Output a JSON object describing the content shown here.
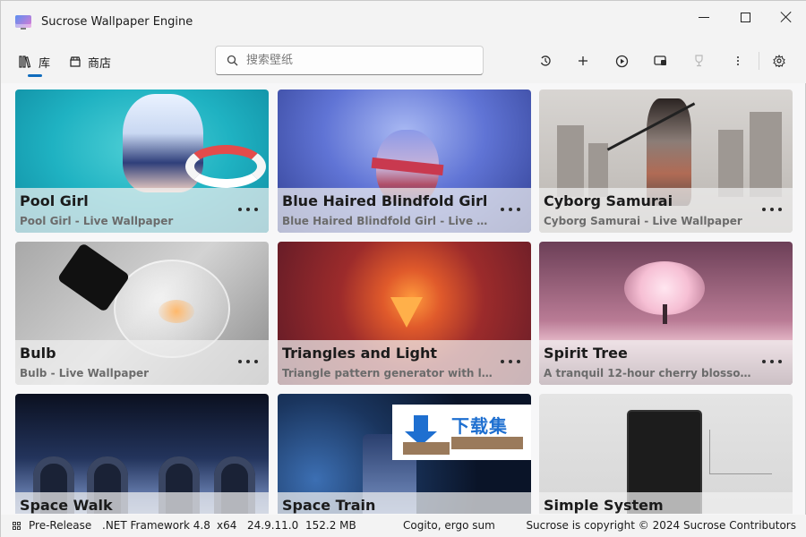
{
  "window": {
    "title": "Sucrose Wallpaper Engine"
  },
  "toolbar": {
    "tabs": [
      {
        "label": "库",
        "icon": "library-icon",
        "active": true
      },
      {
        "label": "商店",
        "icon": "store-icon",
        "active": false
      }
    ],
    "search": {
      "placeholder": "搜索壁纸",
      "value": ""
    },
    "actions": [
      "history-icon",
      "add-icon",
      "play-icon",
      "display-icon",
      "trophy-icon",
      "more-icon",
      "settings-icon"
    ]
  },
  "wallpapers": [
    {
      "title": "Pool Girl",
      "subtitle": "Pool Girl - Live Wallpaper"
    },
    {
      "title": "Blue Haired Blindfold Girl",
      "subtitle": "Blue Haired Blindfold Girl - Live Wal..."
    },
    {
      "title": "Cyborg Samurai",
      "subtitle": "Cyborg Samurai - Live Wallpaper"
    },
    {
      "title": "Bulb",
      "subtitle": "Bulb - Live Wallpaper"
    },
    {
      "title": "Triangles and Light",
      "subtitle": "Triangle pattern generator with ligh..."
    },
    {
      "title": "Spirit Tree",
      "subtitle": "A tranquil 12-hour cherry blossom l..."
    },
    {
      "title": "Space Walk",
      "subtitle": ""
    },
    {
      "title": "Space Train",
      "subtitle": ""
    },
    {
      "title": "Simple System",
      "subtitle": ""
    }
  ],
  "watermark": {
    "text": "下载集"
  },
  "statusbar": {
    "channel": "Pre-Release",
    "framework": ".NET Framework 4.8",
    "arch": "x64",
    "version": "24.9.11.0",
    "memory": "152.2 MB",
    "motto": "Cogito, ergo sum",
    "copyright": "Sucrose is copyright © 2024 Sucrose Contributors"
  },
  "colors": {
    "accent": "#0f6cbd",
    "watermark": "#1e6fd0"
  }
}
